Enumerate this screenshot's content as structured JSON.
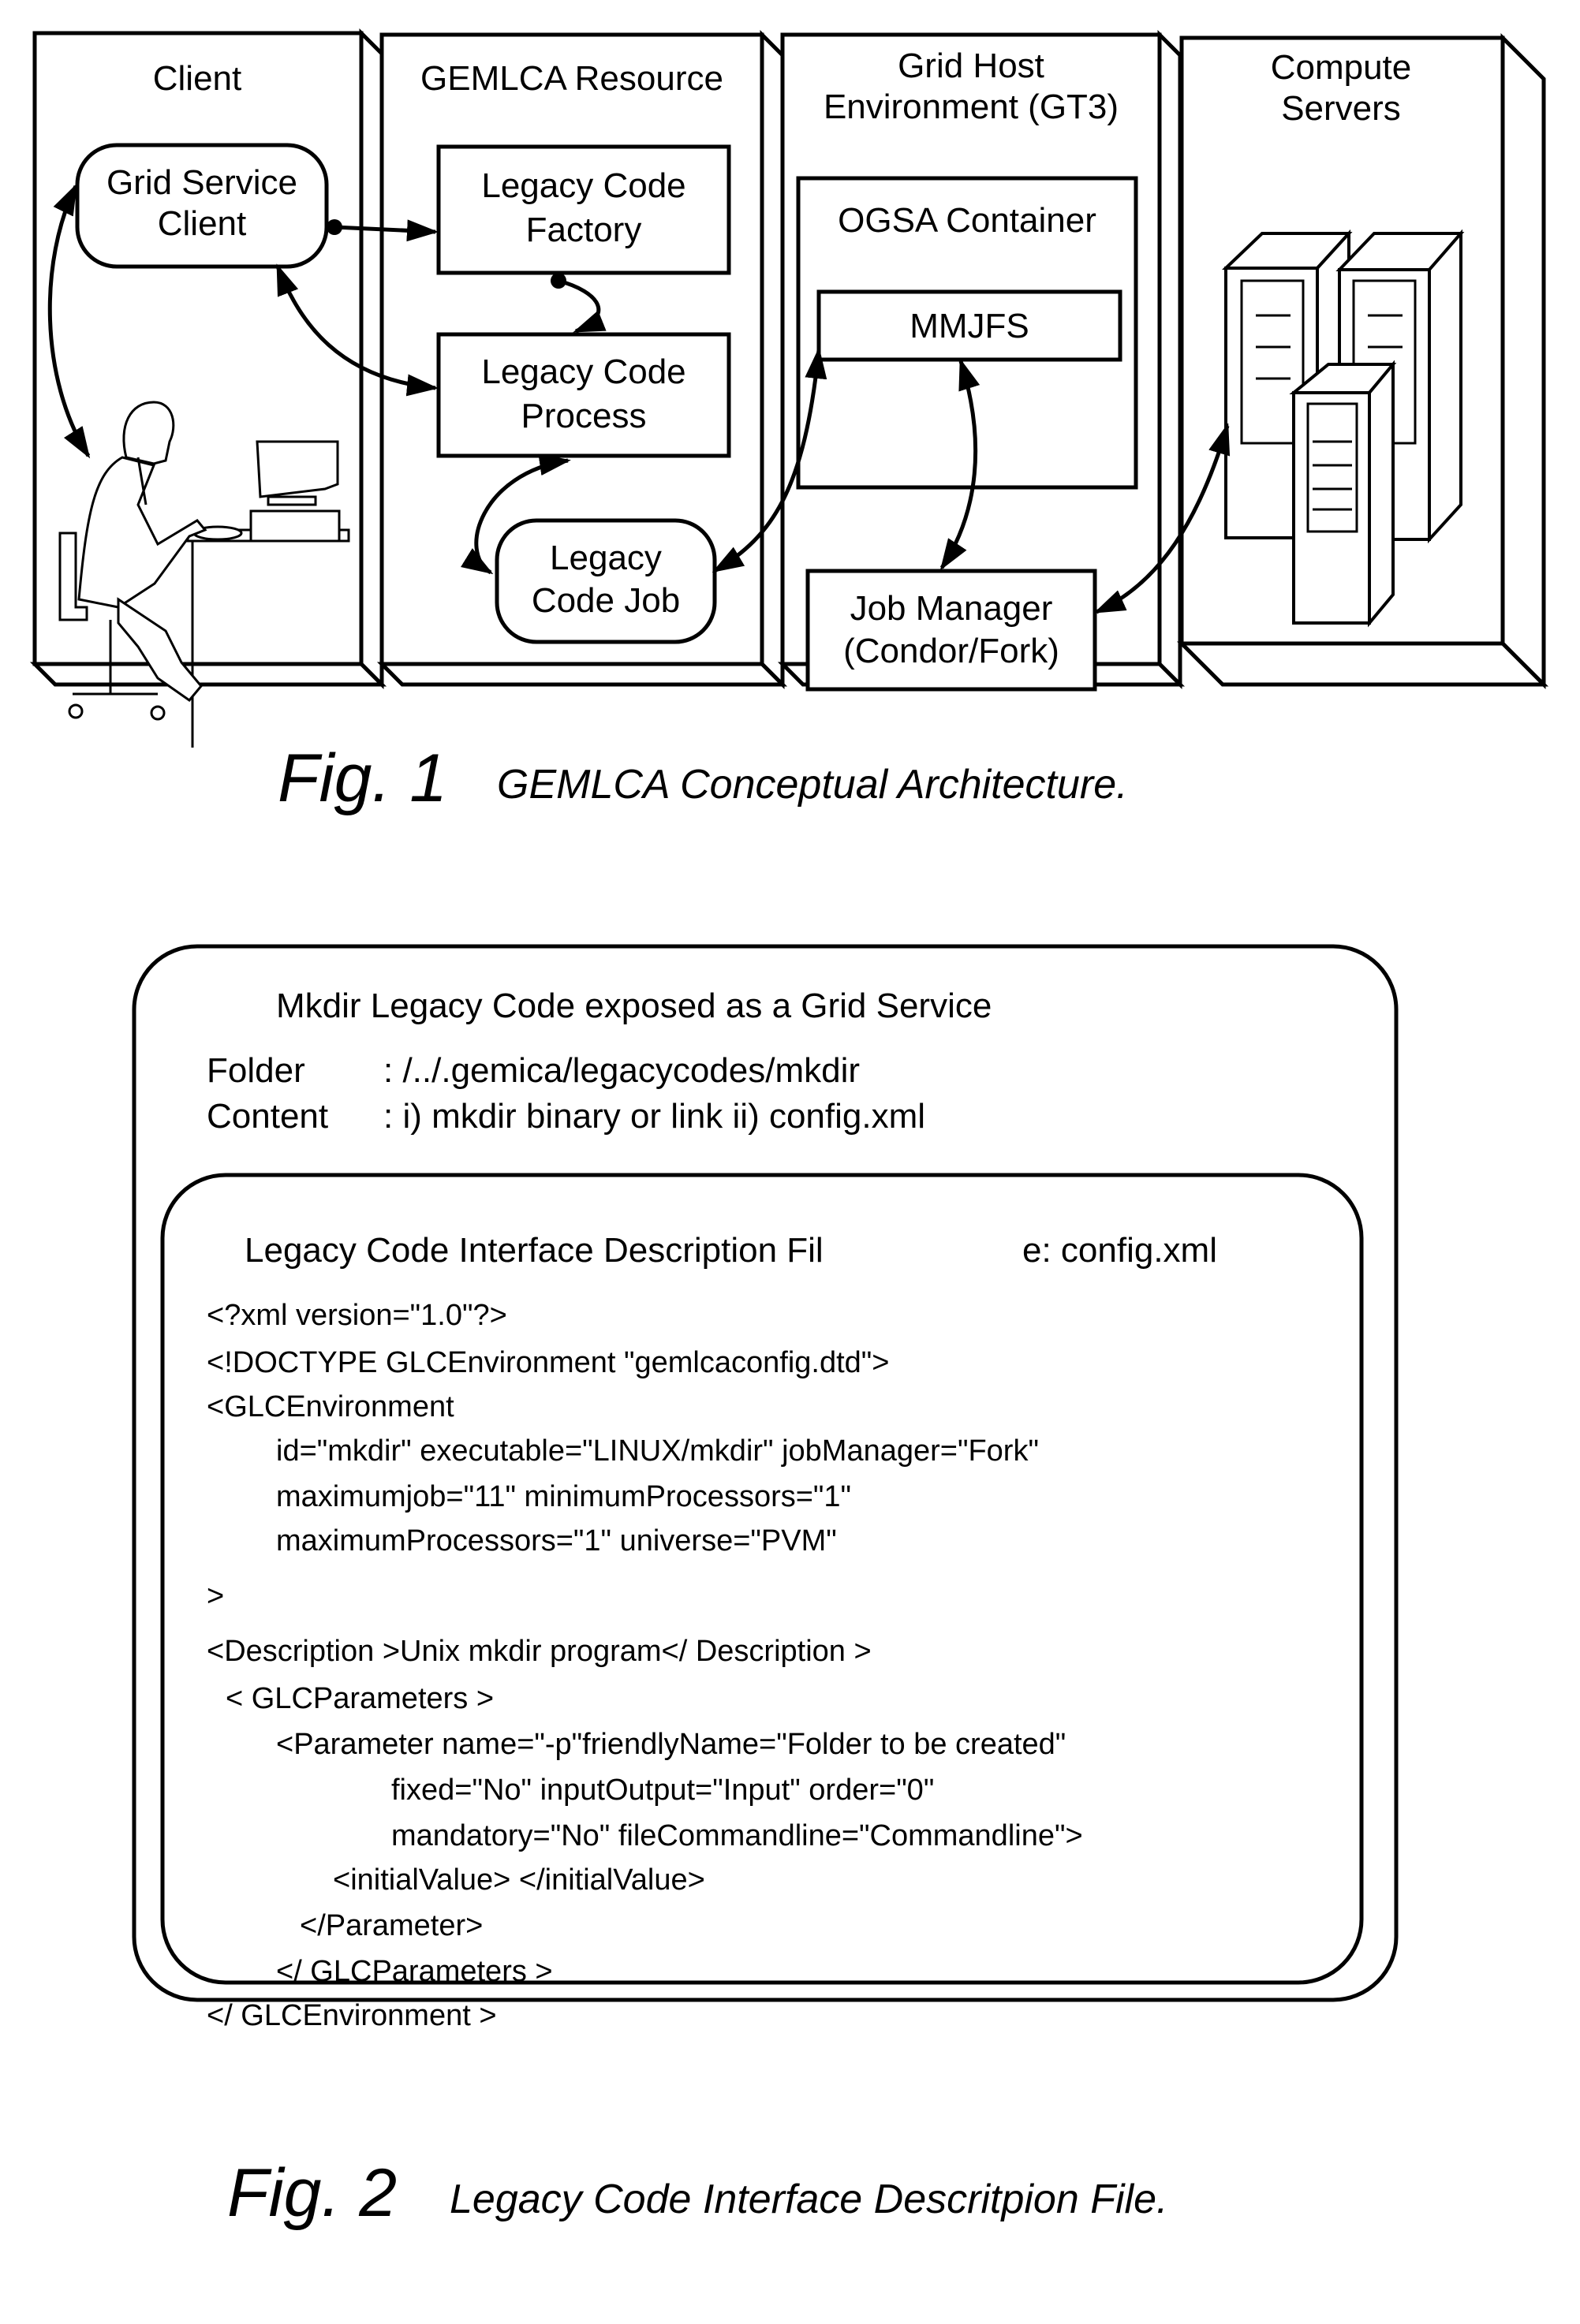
{
  "figure1": {
    "columns": [
      {
        "title_lines": [
          "Client"
        ]
      },
      {
        "title_lines": [
          "GEMLCA Resource"
        ]
      },
      {
        "title_lines": [
          "Grid Host",
          "Environment (GT3)"
        ]
      },
      {
        "title_lines": [
          "Compute",
          "Servers"
        ]
      }
    ],
    "nodes": {
      "grid_service_client": [
        "Grid Service",
        "Client"
      ],
      "legacy_code_factory": [
        "Legacy Code",
        "Factory"
      ],
      "legacy_code_process": [
        "Legacy Code",
        "Process"
      ],
      "legacy_code_job": [
        "Legacy",
        "Code Job"
      ],
      "ogsa_container": "OGSA Container",
      "mmjfs": "MMJFS",
      "job_manager": [
        "Job Manager",
        "(Condor/Fork)"
      ]
    },
    "icons": {
      "user": "person-at-computer-icon",
      "servers": "server-tower-icon"
    },
    "caption": {
      "number": "Fig. 1",
      "text": "GEMLCA Conceptual Architecture."
    }
  },
  "figure2": {
    "outer_title": "Mkdir Legacy Code exposed as a Grid Service",
    "folder_label": "Folder",
    "folder_value": ": /../.gemica/legacycodes/mkdir",
    "content_label": "Content",
    "content_value": ": i) mkdir binary or link ii) config.xml",
    "inner_title_left": "Legacy Code Interface Description Fil",
    "inner_title_right": "e: config.xml",
    "code_lines": [
      "<?xml version=\"1.0\"?>",
      "<!DOCTYPE GLCEnvironment \"gemlcaconfig.dtd\">",
      "<GLCEnvironment",
      "id=\"mkdir\" executable=\"LINUX/mkdir\" jobManager=\"Fork\"",
      "maximumjob=\"11\" minimumProcessors=\"1\"",
      "maximumProcessors=\"1\" universe=\"PVM\"",
      ">",
      "<Description  >Unix mkdir program</  Description  >",
      "< GLCParameters  >",
      "<Parameter name=\"-p\"friendlyName=\"Folder to be created\"",
      "fixed=\"No\" inputOutput=\"Input\" order=\"0\"",
      "mandatory=\"No\" fileCommandline=\"Commandline\">",
      "<initialValue> </initialValue>",
      "</Parameter>",
      "</ GLCParameters     >",
      "</ GLCEnvironment      >"
    ],
    "caption": {
      "number": "Fig. 2",
      "text": "Legacy Code Interface Descritpion File."
    }
  }
}
